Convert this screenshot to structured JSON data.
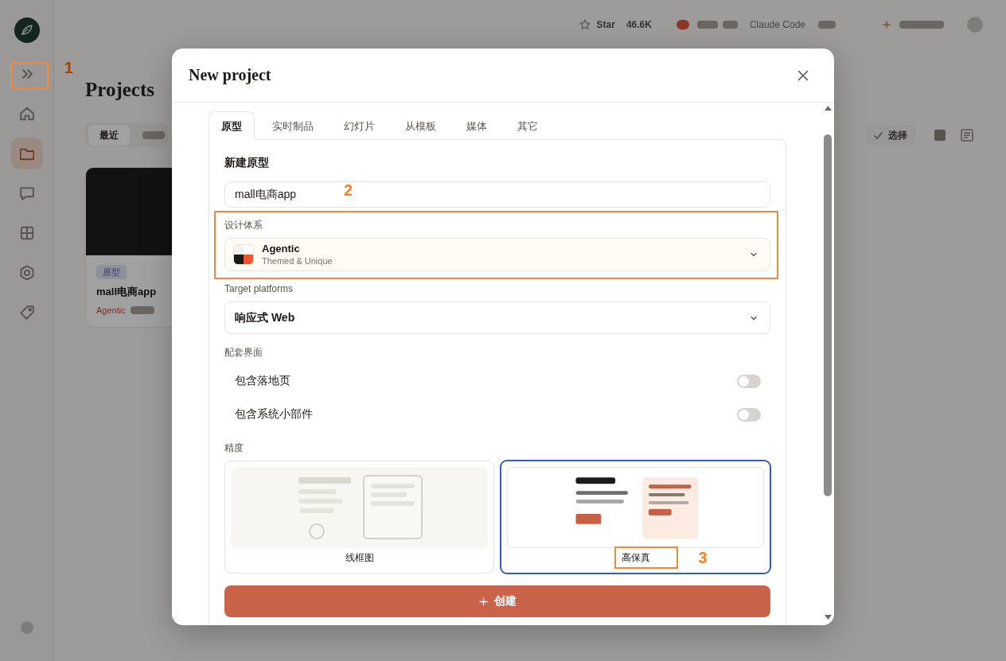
{
  "top_bar": {
    "star_label": "Star",
    "star_count": "46.6K",
    "link": "Claude Code"
  },
  "sidebar": {
    "items": [
      {
        "kind": "expand",
        "selected": false,
        "annotation": "1"
      },
      {
        "kind": "home",
        "selected": false
      },
      {
        "kind": "folder",
        "selected": true
      },
      {
        "kind": "chat",
        "selected": false
      },
      {
        "kind": "grid",
        "selected": false
      },
      {
        "kind": "settings",
        "selected": false
      },
      {
        "kind": "tag",
        "selected": false
      }
    ]
  },
  "page": {
    "title": "Projects",
    "tabs": [
      {
        "label": "最近",
        "selected": true
      }
    ],
    "select_button": "选择",
    "cards": [
      {
        "tag": "原型",
        "title": "mall电商app",
        "design_system": "Agentic"
      }
    ]
  },
  "dialog": {
    "title": "New project",
    "tabs": [
      {
        "label": "原型",
        "selected": true
      },
      {
        "label": "实时制品",
        "selected": false
      },
      {
        "label": "幻灯片",
        "selected": false
      },
      {
        "label": "从模板",
        "selected": false
      },
      {
        "label": "媒体",
        "selected": false
      },
      {
        "label": "其它",
        "selected": false
      }
    ],
    "form": {
      "name_label": "新建原型",
      "name_value": "mall电商app",
      "design_system": {
        "label": "设计体系",
        "name": "Agentic",
        "subtitle": "Themed & Unique",
        "annotation": "2"
      },
      "platforms": {
        "label": "Target platforms",
        "value": "响应式 Web"
      },
      "screens": {
        "label": "配套界面",
        "toggles": [
          {
            "label": "包含落地页",
            "on": false
          },
          {
            "label": "包含系统小部件",
            "on": false
          }
        ]
      },
      "fidelity": {
        "label": "精度",
        "options": [
          {
            "kind": "wireframe",
            "label": "线框图",
            "selected": false
          },
          {
            "kind": "high_fidelity",
            "label": "高保真",
            "selected": true,
            "annotation": "3"
          }
        ]
      },
      "create_label": "创建"
    }
  }
}
